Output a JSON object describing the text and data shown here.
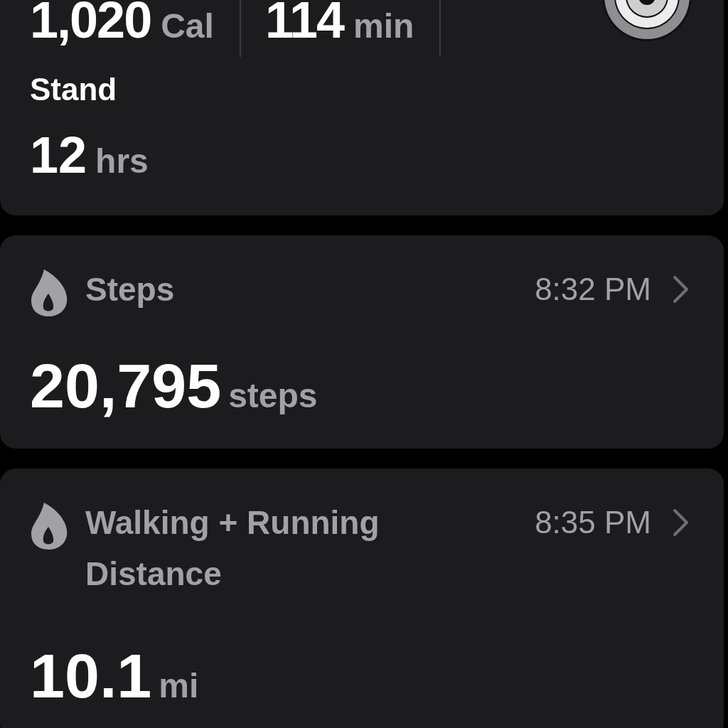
{
  "summary": {
    "metrics": [
      {
        "value": "1,020",
        "unit": "Cal"
      },
      {
        "value": "114",
        "unit": "min"
      }
    ],
    "stand": {
      "label": "Stand",
      "value": "12",
      "unit": "hrs"
    }
  },
  "cards": [
    {
      "title": "Steps",
      "time": "8:32 PM",
      "value": "20,795",
      "unit": "steps"
    },
    {
      "title": "Walking + Running Distance",
      "time": "8:35 PM",
      "value": "10.1",
      "unit": "mi"
    }
  ]
}
